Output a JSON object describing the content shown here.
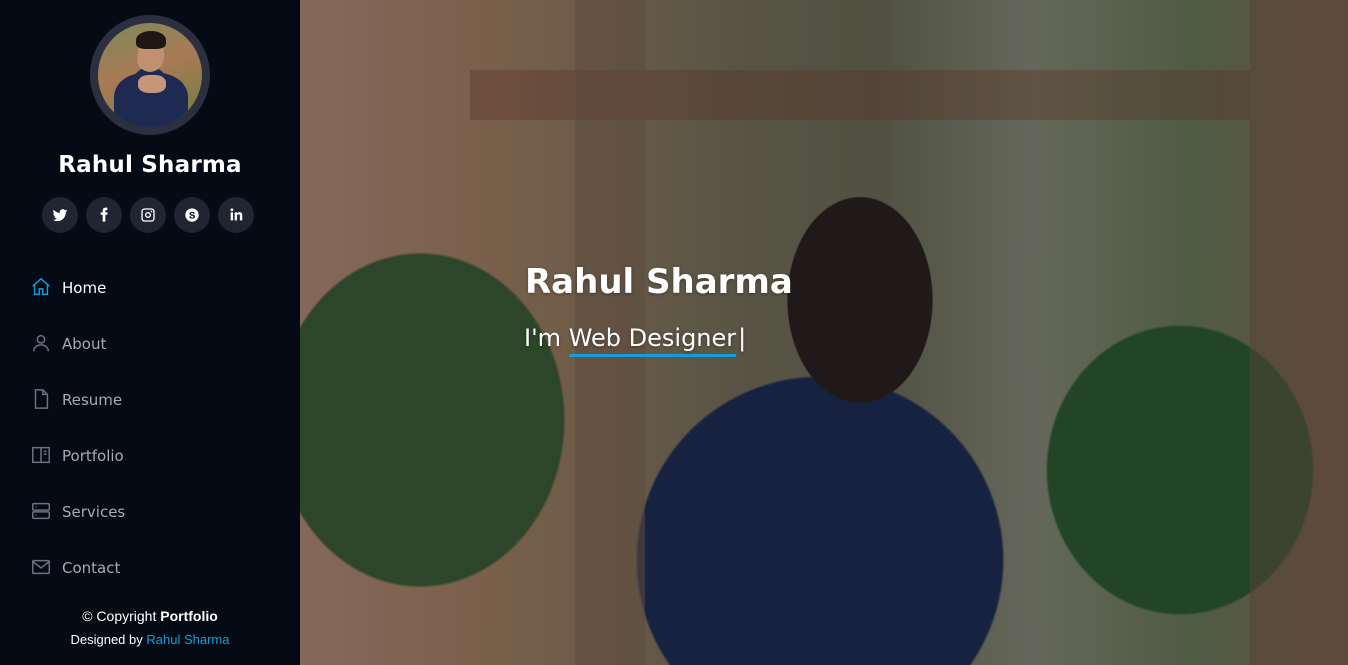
{
  "profile": {
    "name": "Rahul Sharma"
  },
  "social": [
    {
      "icon": "twitter-icon"
    },
    {
      "icon": "facebook-icon"
    },
    {
      "icon": "instagram-icon"
    },
    {
      "icon": "skype-icon"
    },
    {
      "icon": "linkedin-icon"
    }
  ],
  "nav": {
    "items": [
      {
        "label": "Home",
        "icon": "home-icon",
        "active": true
      },
      {
        "label": "About",
        "icon": "person-icon"
      },
      {
        "label": "Resume",
        "icon": "file-icon"
      },
      {
        "label": "Portfolio",
        "icon": "book-icon"
      },
      {
        "label": "Services",
        "icon": "server-icon"
      },
      {
        "label": "Contact",
        "icon": "envelope-icon"
      }
    ]
  },
  "footer": {
    "copyright_prefix": "© Copyright",
    "copyright_brand": "Portfolio",
    "designed_by_prefix": "Designed by",
    "designed_by_name": "Rahul Sharma"
  },
  "hero": {
    "title": "Rahul Sharma",
    "subtitle_prefix": "I'm",
    "subtitle_typed": "Web Designer",
    "cursor": "|"
  },
  "colors": {
    "accent": "#149ddd",
    "sidebar_bg": "#040b14",
    "nav_text": "#a8a9b4"
  }
}
